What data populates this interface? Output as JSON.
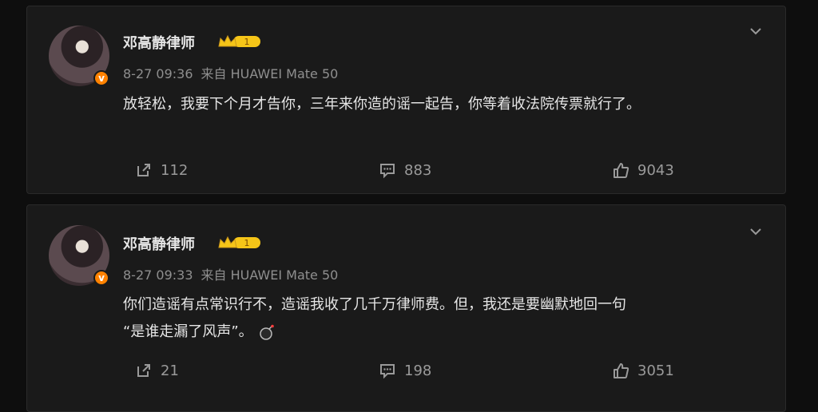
{
  "posts": [
    {
      "author": "邓高静律师",
      "time": "8-27 09:36",
      "source": "来自 HUAWEI Mate 50",
      "text_lines": [
        "放轻松，我要下个月才告你，三年来你造的谣一起告，你等着收法院传票就行了。"
      ],
      "repost_count": "112",
      "comment_count": "883",
      "like_count": "9043"
    },
    {
      "author": "邓高静律师",
      "time": "8-27 09:33",
      "source": "来自 HUAWEI Mate 50",
      "text_lines": [
        "你们造谣有点常识行不，造谣我收了几千万律师费。但，我还是要幽默地回一句",
        "“是谁走漏了风声”。"
      ],
      "repost_count": "21",
      "comment_count": "198",
      "like_count": "3051"
    }
  ],
  "icons": {
    "verified": "verified-badge-icon",
    "vip": "vip-crown-level1-icon",
    "more": "chevron-down-icon",
    "repost": "repost-icon",
    "comment": "comment-icon",
    "like": "thumbs-up-icon",
    "bomb": "bomb-emoji-icon"
  },
  "colors": {
    "background": "#0e0e0e",
    "card": "#1a1a1a",
    "text": "#e6e6e6",
    "meta": "#8f8f8f",
    "verified_orange": "#ff8200",
    "vip_gold": "#f5c518"
  }
}
